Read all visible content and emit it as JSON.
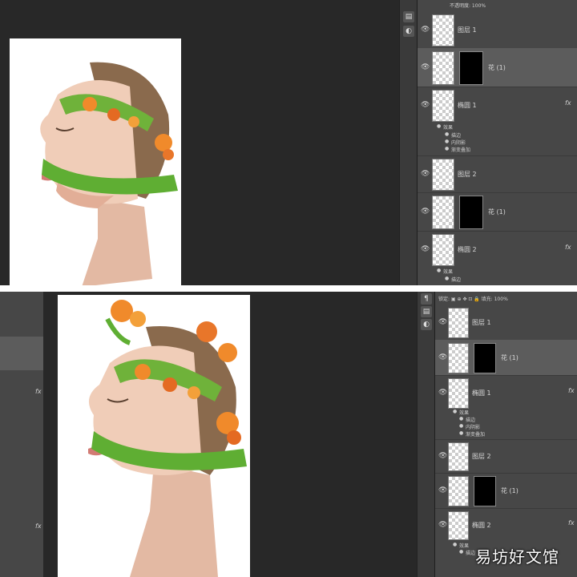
{
  "top": {
    "options_text": "不透明度: 100%",
    "layers": [
      {
        "name": "图层 1"
      },
      {
        "name": "花 (1)"
      },
      {
        "name": "椭圆 1",
        "fx": "fx",
        "effects_label": "效果",
        "effects": [
          "描边",
          "内阴影",
          "渐变叠加"
        ]
      },
      {
        "name": "图层 2"
      },
      {
        "name": "花 (1)"
      },
      {
        "name": "椭圆 2",
        "fx": "fx",
        "effects_label": "效果",
        "effects": [
          "描边",
          "内阴影"
        ]
      }
    ]
  },
  "bottom": {
    "options_text": "锁定: ▣ ⊕ ✥ ⊡ 🔒 填充: 100%",
    "left_fx": "fx",
    "left_fx2": "fx",
    "layers": [
      {
        "name": "图层 1"
      },
      {
        "name": "花 (1)"
      },
      {
        "name": "椭圆 1",
        "fx": "fx",
        "effects_label": "效果",
        "effects": [
          "描边",
          "内阴影",
          "渐变叠加"
        ]
      },
      {
        "name": "图层 2"
      },
      {
        "name": "花 (1)"
      },
      {
        "name": "椭圆 2",
        "fx": "fx",
        "effects_label": "效果",
        "effects": [
          "描边"
        ]
      }
    ]
  },
  "watermark": "易坊好文馆"
}
